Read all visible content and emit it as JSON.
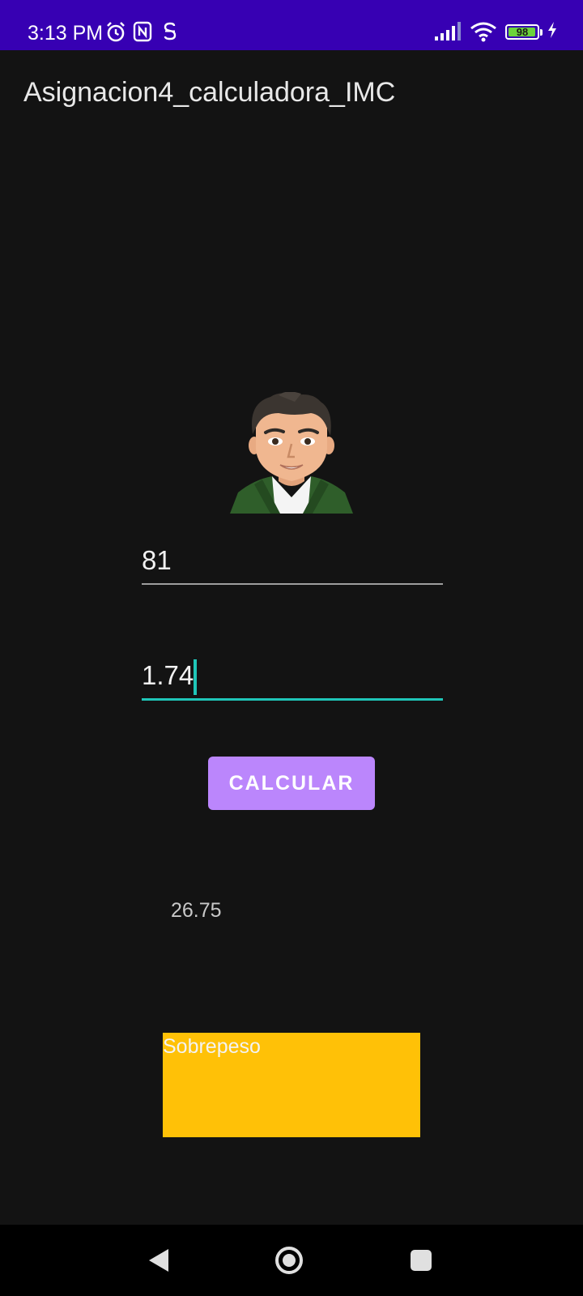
{
  "status_bar": {
    "time": "3:13 PM",
    "battery_level": "98",
    "battery_fraction": 0.98,
    "icons": [
      "alarm-icon",
      "nfc-icon",
      "app-s-icon",
      "signal-icon",
      "wifi-icon",
      "battery-icon",
      "charging-icon"
    ],
    "background_color": "#3700b3"
  },
  "app_bar": {
    "title": "Asignacion4_calculadora_IMC"
  },
  "avatar": {
    "icon": "person-avatar-icon"
  },
  "form": {
    "weight_value": "81",
    "height_value": "1.74",
    "accent_color": "#1fc6b8"
  },
  "actions": {
    "calculate_label": "CALCULAR",
    "button_color": "#bb86fc"
  },
  "result": {
    "imc_value": "26.75",
    "category_label": "Sobrepeso",
    "category_color": "#ffc107"
  },
  "nav_bar": {
    "icons": [
      "back-icon",
      "home-icon",
      "recents-icon"
    ]
  }
}
